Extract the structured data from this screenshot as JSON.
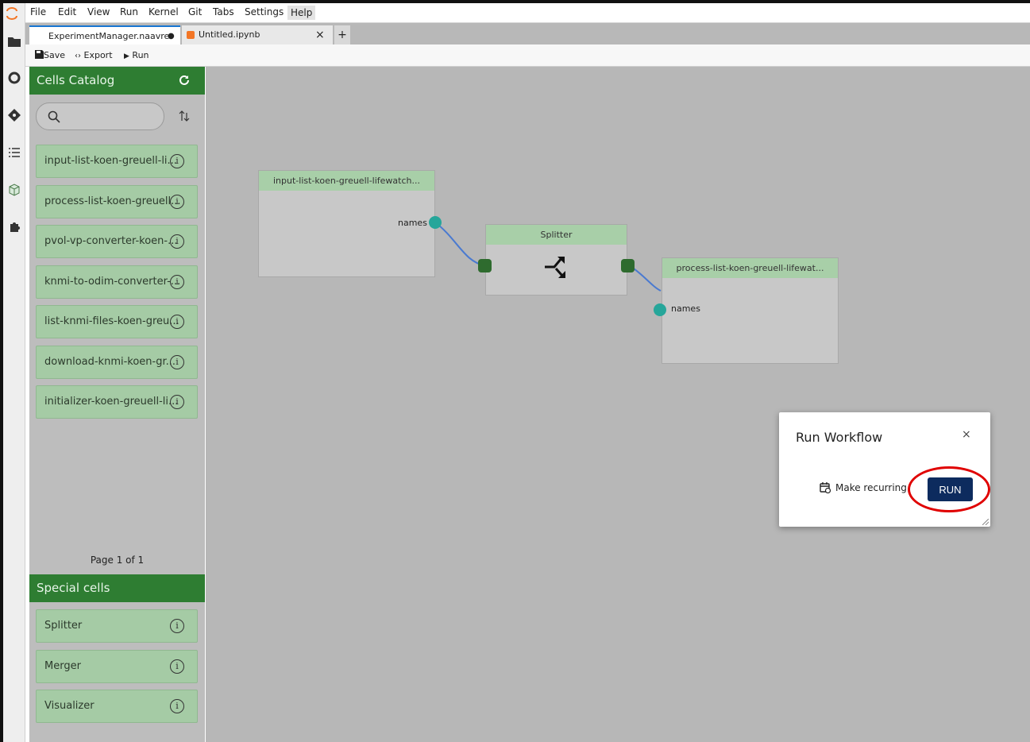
{
  "menu": {
    "items": [
      "File",
      "Edit",
      "View",
      "Run",
      "Kernel",
      "Git",
      "Tabs",
      "Settings",
      "Help"
    ]
  },
  "tabs": [
    {
      "label": "ExperimentManager.naavre",
      "dirty": "●"
    },
    {
      "label": "Untitled.ipynb",
      "close": "×"
    }
  ],
  "new_tab": "+",
  "toolbar": {
    "save": "Save",
    "export": "Export",
    "run": "Run"
  },
  "catalog": {
    "title": "Cells Catalog",
    "cells": [
      "input-list-koen-greuell-li...",
      "process-list-koen-greuell...",
      "pvol-vp-converter-koen-...",
      "knmi-to-odim-converter-...",
      "list-knmi-files-koen-greu...",
      "download-knmi-koen-gr...",
      "initializer-koen-greuell-li..."
    ],
    "pager": "Page 1 of 1"
  },
  "special": {
    "title": "Special cells",
    "cells": [
      "Splitter",
      "Merger",
      "Visualizer"
    ]
  },
  "info_glyph": "i",
  "nodes": {
    "input": {
      "title": "input-list-koen-greuell-lifewatch...",
      "port": "names"
    },
    "splitter": {
      "title": "Splitter"
    },
    "process": {
      "title": "process-list-koen-greuell-lifewat...",
      "port": "names"
    }
  },
  "dialog": {
    "title": "Run Workflow",
    "close": "×",
    "recurring": "Make recurring",
    "run": "RUN"
  },
  "colors": {
    "accent_green": "#2e7d32",
    "run_button": "#0d2b5e",
    "highlight": "#e00000"
  }
}
